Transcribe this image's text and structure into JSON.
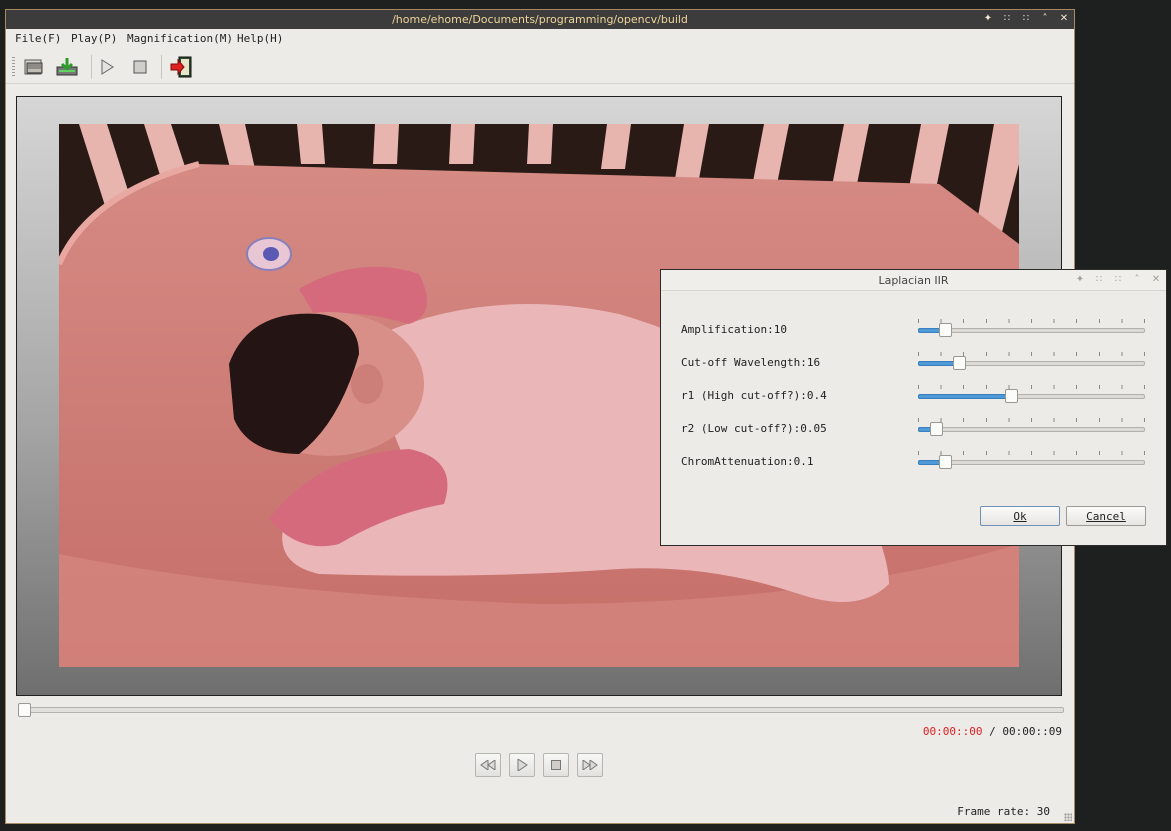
{
  "window": {
    "title": "/home/ehome/Documents/programming/opencv/build"
  },
  "menu": [
    "File(F)",
    "Play(P)",
    "Magnification(M)",
    "Help(H)"
  ],
  "toolbar": [
    "open-file-icon",
    "save-icon",
    "play-icon",
    "stop-icon",
    "exit-icon"
  ],
  "player": {
    "position_fraction": 0.0,
    "time_current": "00:00::00",
    "time_separator": "/",
    "time_total": "00:00::09",
    "frame_rate": "Frame rate: 30",
    "controls": [
      "rewind-icon",
      "play-icon",
      "stop-icon",
      "fast-forward-icon"
    ]
  },
  "dialog": {
    "title": "Laplacian IIR",
    "params": [
      {
        "label": "Amplification:10",
        "fraction": 0.12
      },
      {
        "label": "Cut-off Wavelength:16",
        "fraction": 0.18
      },
      {
        "label": "r1 (High cut-off?):0.4",
        "fraction": 0.41
      },
      {
        "label": "r2 (Low cut-off?):0.05",
        "fraction": 0.08
      },
      {
        "label": "ChromAttenuation:0.1",
        "fraction": 0.12
      }
    ],
    "ok_label": "Ok",
    "cancel_label": "Cancel"
  },
  "colors": {
    "time_current": "#e02020",
    "slider_fill": "#4e9ad8",
    "title_text": "#f0d49a"
  }
}
